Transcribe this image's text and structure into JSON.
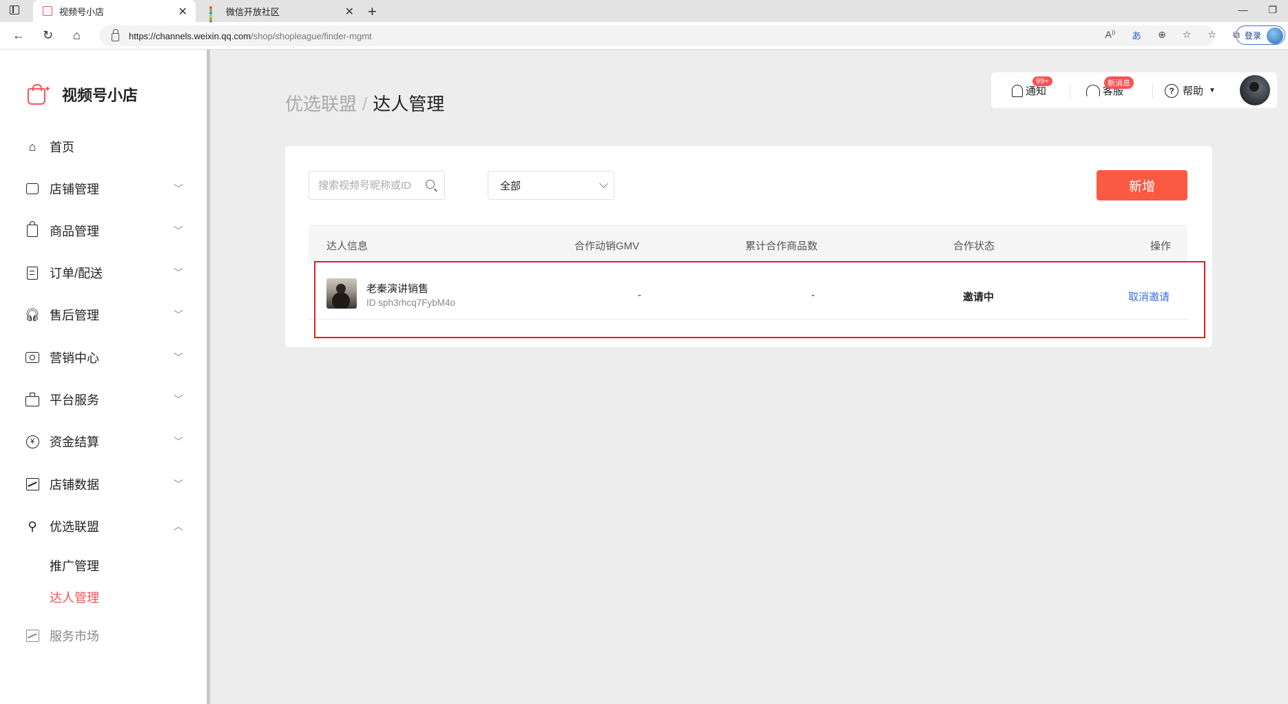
{
  "browser": {
    "tabs": [
      {
        "label": "视频号小店",
        "active": true
      },
      {
        "label": "微信开放社区",
        "active": false
      }
    ],
    "url_host": "https://channels.weixin.qq.com",
    "url_path": "/shop/shopleague/finder-mgmt",
    "login_label": "登录"
  },
  "sidebar": {
    "logo_text": "视频号小店",
    "items": [
      {
        "label": "首页",
        "icon": "home-icon"
      },
      {
        "label": "店铺管理",
        "icon": "store-icon"
      },
      {
        "label": "商品管理",
        "icon": "bag-icon"
      },
      {
        "label": "订单/配送",
        "icon": "order-icon"
      },
      {
        "label": "售后管理",
        "icon": "headset-icon"
      },
      {
        "label": "营销中心",
        "icon": "ticket-icon"
      },
      {
        "label": "平台服务",
        "icon": "briefcase-icon"
      },
      {
        "label": "资金结算",
        "icon": "yen-icon"
      },
      {
        "label": "店铺数据",
        "icon": "chart-icon"
      },
      {
        "label": "优选联盟",
        "icon": "network-icon",
        "expanded": true
      }
    ],
    "sub_items": [
      {
        "label": "推广管理",
        "active": false
      },
      {
        "label": "达人管理",
        "active": true
      }
    ],
    "service_market": "服务市场"
  },
  "header": {
    "breadcrumb_parent": "优选联盟",
    "breadcrumb_separator": "/",
    "breadcrumb_current": "达人管理",
    "notify_label": "通知",
    "notify_badge": "99+",
    "service_label": "客服",
    "service_badge": "新消息",
    "help_label": "帮助"
  },
  "filters": {
    "search_placeholder": "搜索视频号昵称或ID",
    "select_value": "全部",
    "add_button": "新增"
  },
  "table": {
    "headers": [
      "达人信息",
      "合作动销GMV",
      "累计合作商品数",
      "合作状态",
      "操作"
    ],
    "rows": [
      {
        "name": "老秦演讲销售",
        "id": "ID sph3rhcq7FybM4o",
        "gmv": "-",
        "product_count": "-",
        "status": "邀请中",
        "action": "取消邀请"
      }
    ]
  },
  "colors": {
    "accent": "#fa5151",
    "primary_button": "#fa5a41",
    "link": "#3a6fd8",
    "highlight_border": "#e02020"
  }
}
